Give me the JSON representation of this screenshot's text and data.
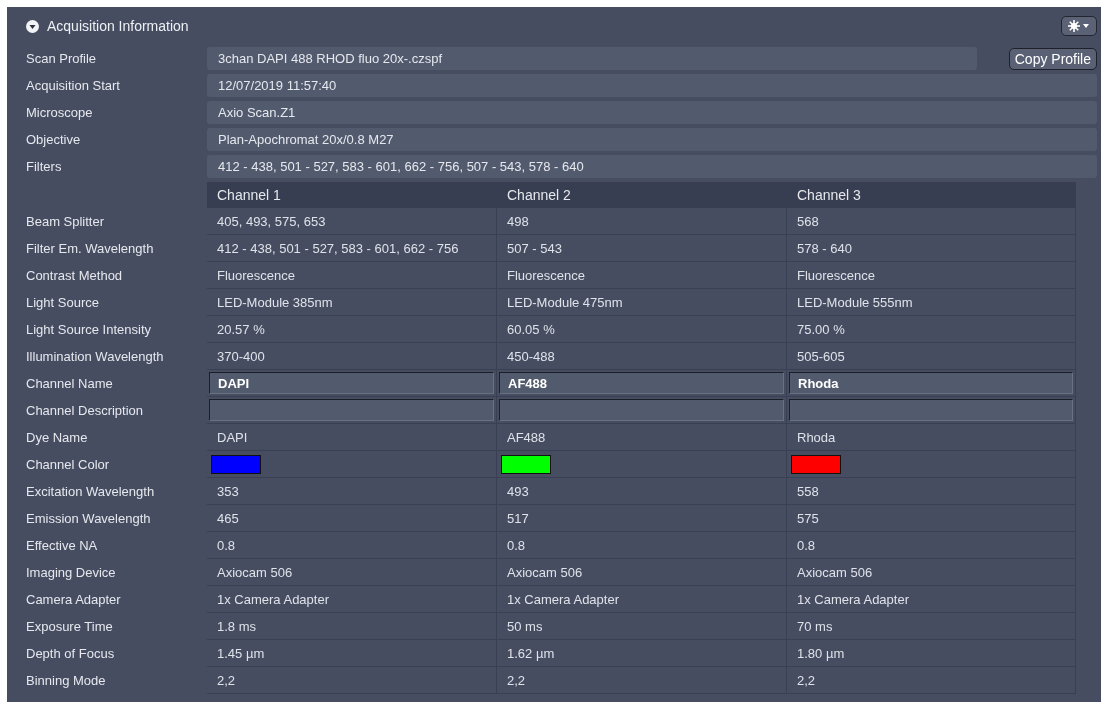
{
  "panel": {
    "title": "Acquisition Information",
    "expanded": true
  },
  "info_rows": [
    {
      "label": "Scan Profile",
      "value": "3chan DAPI 488 RHOD fluo 20x-.czspf",
      "button": "Copy Profile"
    },
    {
      "label": "Acquisition Start",
      "value": "12/07/2019 11:57:40"
    },
    {
      "label": "Microscope",
      "value": "Axio Scan.Z1"
    },
    {
      "label": "Objective",
      "value": "Plan-Apochromat 20x/0.8 M27"
    },
    {
      "label": "Filters",
      "value": "412 - 438, 501 - 527, 583 - 601, 662 - 756, 507 - 543, 578 - 640"
    }
  ],
  "channel_table": {
    "columns": [
      "Channel 1",
      "Channel 2",
      "Channel 3"
    ],
    "rows": [
      {
        "kind": "text",
        "label": "Beam Splitter",
        "cells": [
          "405, 493, 575, 653",
          "498",
          "568"
        ]
      },
      {
        "kind": "text",
        "label": "Filter Em. Wavelength",
        "cells": [
          "412 - 438, 501 - 527, 583 - 601, 662 - 756",
          "507 - 543",
          "578 - 640"
        ]
      },
      {
        "kind": "text",
        "label": "Contrast Method",
        "cells": [
          "Fluorescence",
          "Fluorescence",
          "Fluorescence"
        ]
      },
      {
        "kind": "text",
        "label": "Light Source",
        "cells": [
          "LED-Module 385nm",
          "LED-Module 475nm",
          "LED-Module 555nm"
        ]
      },
      {
        "kind": "text",
        "label": "Light Source Intensity",
        "cells": [
          "20.57 %",
          "60.05 %",
          "75.00 %"
        ]
      },
      {
        "kind": "text",
        "label": "Illumination Wavelength",
        "cells": [
          "370-400",
          "450-488",
          "505-605"
        ]
      },
      {
        "kind": "input",
        "label": "Channel Name",
        "cells": [
          "DAPI",
          "AF488",
          "Rhoda"
        ]
      },
      {
        "kind": "input",
        "label": "Channel Description",
        "cells": [
          "",
          "",
          ""
        ]
      },
      {
        "kind": "text",
        "label": "Dye Name",
        "cells": [
          "DAPI",
          "AF488",
          "Rhoda"
        ]
      },
      {
        "kind": "color",
        "label": "Channel Color",
        "swatches": [
          {
            "color": "#0000ff"
          },
          {
            "color": "#00ff00"
          },
          {
            "color": "#ff0000"
          }
        ]
      },
      {
        "kind": "text",
        "label": "Excitation Wavelength",
        "cells": [
          "353",
          "493",
          "558"
        ]
      },
      {
        "kind": "text",
        "label": "Emission Wavelength",
        "cells": [
          "465",
          "517",
          "575"
        ]
      },
      {
        "kind": "text",
        "label": "Effective NA",
        "cells": [
          "0.8",
          "0.8",
          "0.8"
        ]
      },
      {
        "kind": "text",
        "label": "Imaging Device",
        "cells": [
          "Axiocam 506",
          "Axiocam 506",
          "Axiocam 506"
        ]
      },
      {
        "kind": "text",
        "label": "Camera Adapter",
        "cells": [
          "1x Camera Adapter",
          "1x Camera Adapter",
          "1x Camera Adapter"
        ]
      },
      {
        "kind": "text",
        "label": "Exposure Time",
        "cells": [
          "1.8 ms",
          "50 ms",
          "70 ms"
        ]
      },
      {
        "kind": "text",
        "label": "Depth of Focus",
        "cells": [
          "1.45 µm",
          "1.62 µm",
          "1.80 µm"
        ]
      },
      {
        "kind": "text",
        "label": "Binning Mode",
        "cells": [
          "2,2",
          "2,2",
          "2,2"
        ]
      }
    ]
  }
}
